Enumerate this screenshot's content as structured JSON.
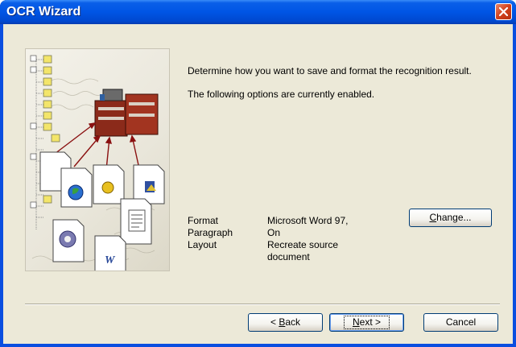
{
  "window": {
    "title": "OCR Wizard"
  },
  "description": {
    "line1": "Determine how you want to save and format the recognition result.",
    "line2": "The following options are currently enabled."
  },
  "options": [
    {
      "label": "Format",
      "value": "Microsoft Word 97,"
    },
    {
      "label": "Paragraph",
      "value": "On"
    },
    {
      "label": "Layout",
      "value": "Recreate source document"
    }
  ],
  "buttons": {
    "change": {
      "pre": "",
      "key": "C",
      "post": "hange..."
    },
    "back": {
      "pre": "< ",
      "key": "B",
      "post": "ack"
    },
    "next": {
      "pre": "",
      "key": "N",
      "post": "ext >"
    },
    "cancel": "Cancel"
  },
  "icons": [
    "close-icon",
    "wizard-illustration"
  ],
  "colors": {
    "titlebar": "#0055e5",
    "client": "#ece9d8",
    "close": "#d1401c"
  }
}
